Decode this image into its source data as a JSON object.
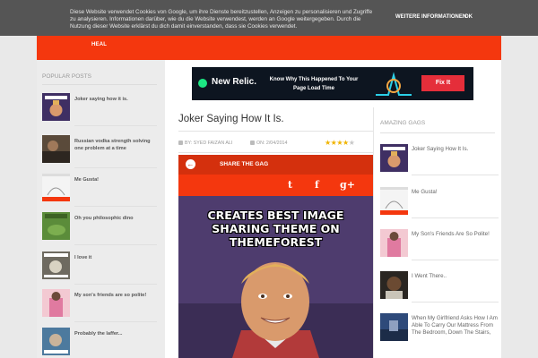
{
  "cookie_bar": {
    "text": "Diese Website verwendet Cookies von Google, um ihre Dienste bereitzustellen, Anzeigen zu personalisieren und Zugriffe zu analysieren. Informationen darüber, wie du die Website verwendest, werden an Google weitergegeben. Durch die Nutzung dieser Website erklärst du dich damit einverstanden, dass sie Cookies verwendet.",
    "more_label": "WEITERE INFORMATIONEN",
    "ok_label": "OK"
  },
  "nav": {
    "item": "HEAL"
  },
  "left_sidebar": {
    "title": "POPULAR POSTS",
    "items": [
      {
        "label": "Joker saying how it is."
      },
      {
        "label": "Russian vodka strength solving one problem at a time"
      },
      {
        "label": "Me Gusta!"
      },
      {
        "label": "Oh you philosophic dino"
      },
      {
        "label": "I love it"
      },
      {
        "label": "My son's friends are so polite!"
      },
      {
        "label": "Probably the laffer..."
      }
    ]
  },
  "ad": {
    "logo": "New Relic.",
    "tagline": "Know Why This Happened To Your Page Load Time",
    "button": "Fix It"
  },
  "post": {
    "title": "Joker Saying How It Is.",
    "author": "BY: SYED FAIZAN ALI",
    "date": "ON: 2/04/2014",
    "rating": 4
  },
  "share": {
    "label": "SHARE THE GAG",
    "twitter": "t",
    "facebook": "f",
    "google": "g+"
  },
  "meme": {
    "caption": "CREATES BEST IMAGE SHARING THEME ON THEMEFOREST"
  },
  "right_sidebar": {
    "title": "AMAZING GAGS",
    "items": [
      {
        "label": "Joker Saying How It Is."
      },
      {
        "label": "Me Gusta!"
      },
      {
        "label": "My Son's Friends Are So Polite!"
      },
      {
        "label": "I Went There.."
      },
      {
        "label": "When My Girlfriend Asks How I Am Able To Carry Our Mattress From The Bedroom, Down The Stairs,"
      }
    ]
  },
  "colors": {
    "accent": "#f4370e",
    "meme_bg": "#4e3c6e"
  }
}
